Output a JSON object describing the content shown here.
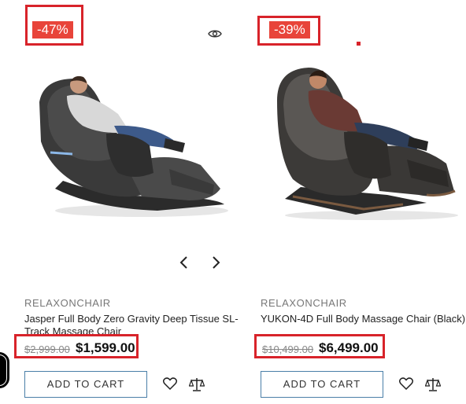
{
  "products": [
    {
      "badge": "-47%",
      "brand": "RELAXONCHAIR",
      "title": "Jasper Full Body Zero Gravity Deep Tissue SL-Track Massage Chair",
      "old_price": "$2,999.00",
      "new_price": "$1,599.00",
      "cart_label": "ADD TO CART"
    },
    {
      "badge": "-39%",
      "brand": "RELAXONCHAIR",
      "title": "YUKON-4D Full Body Massage Chair (Black)",
      "old_price": "$10,499.00",
      "new_price": "$6,499.00",
      "cart_label": "ADD TO CART"
    }
  ],
  "icons": {
    "quick_view": "eye-icon",
    "prev": "chevron-left-icon",
    "next": "chevron-right-icon",
    "wishlist": "heart-icon",
    "compare": "scale-icon"
  },
  "colors": {
    "badge": "#e8443a",
    "highlight_outline": "#d8232a",
    "button_border": "#4a7fa8"
  }
}
